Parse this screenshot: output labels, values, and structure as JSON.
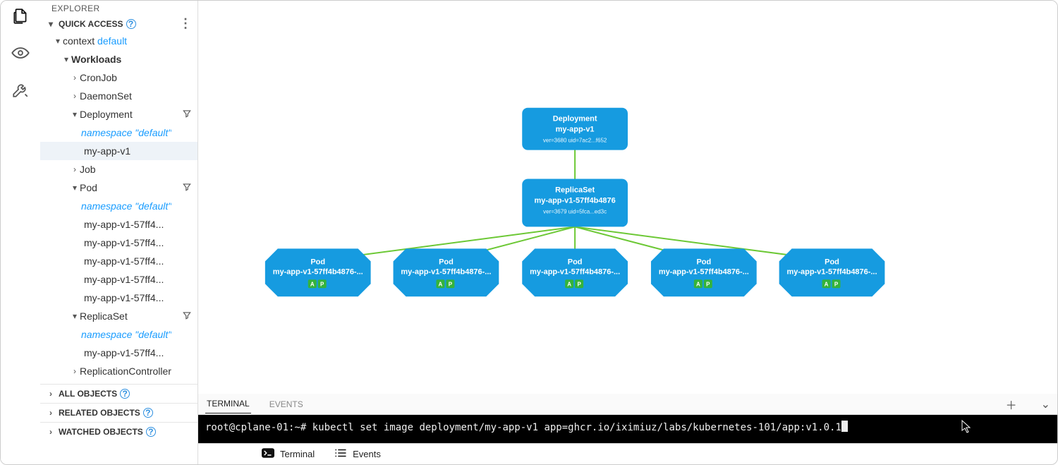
{
  "sidebar": {
    "title": "EXPLORER",
    "sections": {
      "quick_access": "QUICK ACCESS",
      "all_objects": "ALL OBJECTS",
      "related_objects": "RELATED OBJECTS",
      "watched_objects": "WATCHED OBJECTS"
    },
    "context_label": "context",
    "context_name": "default",
    "workloads": {
      "label": "Workloads",
      "items": {
        "cronjob": "CronJob",
        "daemonset": "DaemonSet",
        "deployment": {
          "label": "Deployment",
          "namespace": "namespace \"default\"",
          "children": [
            "my-app-v1"
          ]
        },
        "job": "Job",
        "pod": {
          "label": "Pod",
          "namespace": "namespace \"default\"",
          "children": [
            "my-app-v1-57ff4...",
            "my-app-v1-57ff4...",
            "my-app-v1-57ff4...",
            "my-app-v1-57ff4...",
            "my-app-v1-57ff4..."
          ]
        },
        "replicaset": {
          "label": "ReplicaSet",
          "namespace": "namespace \"default\"",
          "children": [
            "my-app-v1-57ff4..."
          ]
        },
        "replicationcontroller": "ReplicationController"
      }
    }
  },
  "graph": {
    "deployment": {
      "type": "Deployment",
      "name": "my-app-v1",
      "meta": "ver=3680 uid=7ac2...f652"
    },
    "replicaset": {
      "type": "ReplicaSet",
      "name": "my-app-v1-57ff4b4876",
      "meta": "ver=3679 uid=5fca...ed3c"
    },
    "pod": {
      "type": "Pod",
      "name_prefix": "my-app-v1-57ff4b4876-..."
    }
  },
  "panel": {
    "tabs": {
      "terminal": "TERMINAL",
      "events": "EVENTS"
    }
  },
  "terminal": {
    "prompt": "root@cplane-01:~#",
    "command": "kubectl set image deployment/my-app-v1 app=ghcr.io/iximiuz/labs/kubernetes-101/app:v1.0.1"
  },
  "status": {
    "terminal": "Terminal",
    "events": "Events"
  }
}
